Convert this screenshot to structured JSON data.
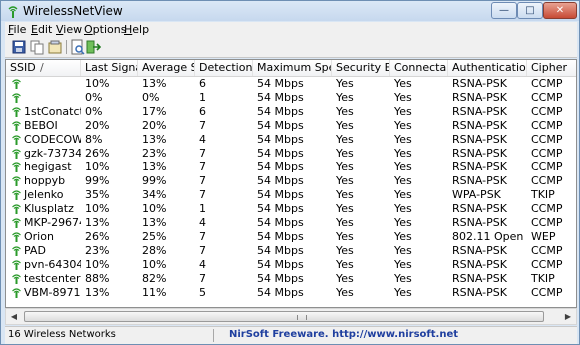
{
  "window": {
    "title": "WirelessNetView",
    "icon": "wifi-signal-icon"
  },
  "menu": [
    "File",
    "Edit",
    "View",
    "Options",
    "Help"
  ],
  "menu_accel": [
    "F",
    "E",
    "V",
    "O",
    "H"
  ],
  "toolbar": [
    {
      "name": "save-icon",
      "title": "Save Selected Items"
    },
    {
      "name": "copy-icon",
      "title": "Copy Selected Items"
    },
    {
      "name": "properties-icon",
      "title": "Properties"
    },
    {
      "name": "html-report-icon",
      "title": "HTML Report"
    },
    {
      "name": "exit-icon",
      "title": "Exit"
    }
  ],
  "columns": [
    "SSID",
    "Last Signal",
    "Average Si...",
    "Detection ...",
    "Maximum Speed",
    "Security En...",
    "Connectable",
    "Authentication",
    "Cipher"
  ],
  "sort_indicator": "/",
  "rows": [
    [
      "",
      "10%",
      "13%",
      "6",
      "54 Mbps",
      "Yes",
      "Yes",
      "RSNA-PSK",
      "CCMP"
    ],
    [
      "",
      "0%",
      "0%",
      "1",
      "54 Mbps",
      "Yes",
      "Yes",
      "RSNA-PSK",
      "CCMP"
    ],
    [
      "1stConatct",
      "0%",
      "17%",
      "6",
      "54 Mbps",
      "Yes",
      "Yes",
      "RSNA-PSK",
      "CCMP"
    ],
    [
      "BEBOI",
      "20%",
      "20%",
      "7",
      "54 Mbps",
      "Yes",
      "Yes",
      "RSNA-PSK",
      "CCMP"
    ],
    [
      "CODECOW",
      "8%",
      "13%",
      "4",
      "54 Mbps",
      "Yes",
      "Yes",
      "RSNA-PSK",
      "CCMP"
    ],
    [
      "gzk-73734",
      "26%",
      "23%",
      "7",
      "54 Mbps",
      "Yes",
      "Yes",
      "RSNA-PSK",
      "CCMP"
    ],
    [
      "hegigast",
      "10%",
      "13%",
      "7",
      "54 Mbps",
      "Yes",
      "Yes",
      "RSNA-PSK",
      "CCMP"
    ],
    [
      "hoppyb",
      "99%",
      "99%",
      "7",
      "54 Mbps",
      "Yes",
      "Yes",
      "RSNA-PSK",
      "CCMP"
    ],
    [
      "Jelenko",
      "35%",
      "34%",
      "7",
      "54 Mbps",
      "Yes",
      "Yes",
      "WPA-PSK",
      "TKIP"
    ],
    [
      "Klusplatz",
      "10%",
      "10%",
      "1",
      "54 Mbps",
      "Yes",
      "Yes",
      "RSNA-PSK",
      "CCMP"
    ],
    [
      "MKP-29674",
      "13%",
      "13%",
      "4",
      "54 Mbps",
      "Yes",
      "Yes",
      "RSNA-PSK",
      "CCMP"
    ],
    [
      "Orion",
      "26%",
      "25%",
      "7",
      "54 Mbps",
      "Yes",
      "Yes",
      "802.11 Open",
      "WEP"
    ],
    [
      "PAD",
      "23%",
      "28%",
      "7",
      "54 Mbps",
      "Yes",
      "Yes",
      "RSNA-PSK",
      "CCMP"
    ],
    [
      "pvn-64304",
      "10%",
      "10%",
      "4",
      "54 Mbps",
      "Yes",
      "Yes",
      "RSNA-PSK",
      "CCMP"
    ],
    [
      "testcenter",
      "88%",
      "82%",
      "7",
      "54 Mbps",
      "Yes",
      "Yes",
      "RSNA-PSK",
      "TKIP"
    ],
    [
      "VBM-89713",
      "13%",
      "11%",
      "5",
      "54 Mbps",
      "Yes",
      "Yes",
      "RSNA-PSK",
      "CCMP"
    ]
  ],
  "status": {
    "count": "16 Wireless Networks",
    "link": "NirSoft Freeware.  http://www.nirsoft.net"
  },
  "colors": {
    "accent": "#1f3f9f",
    "wifi_icon": "#2a9a2a"
  }
}
